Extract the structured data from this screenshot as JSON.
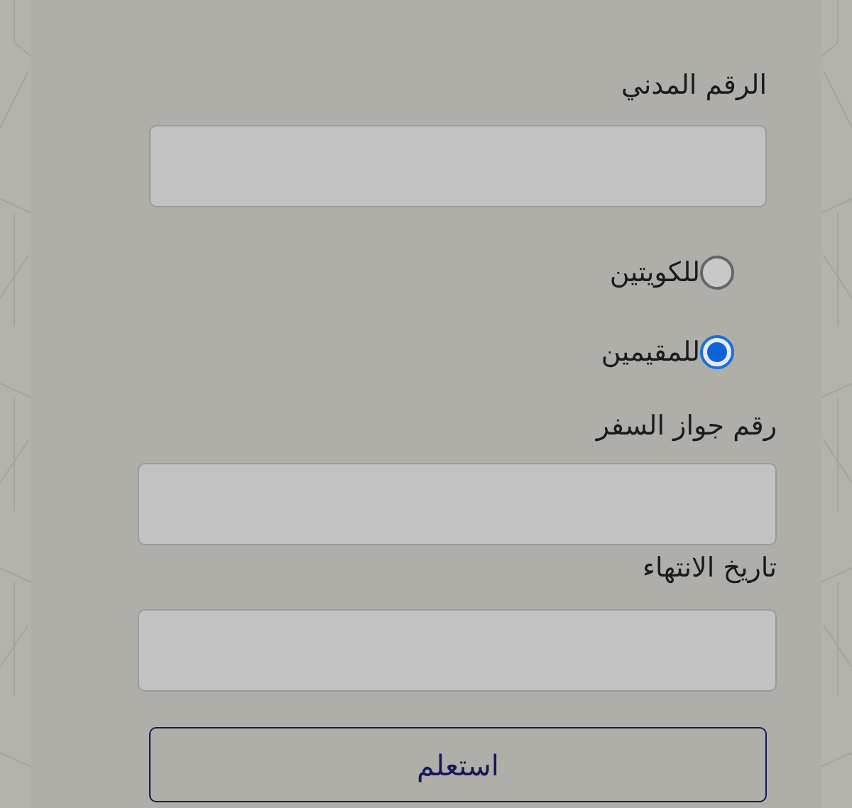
{
  "civil_id": {
    "label": "الرقم المدني"
  },
  "residency": [
    {
      "label": "للكويتين",
      "selected": false
    },
    {
      "label": "للمقيمين",
      "selected": true
    }
  ],
  "passport_number": {
    "label": "رقم جواز السفر"
  },
  "expiry_date": {
    "label": "تاريخ الانتهاء"
  },
  "submit_button": {
    "label": "استعلم"
  }
}
